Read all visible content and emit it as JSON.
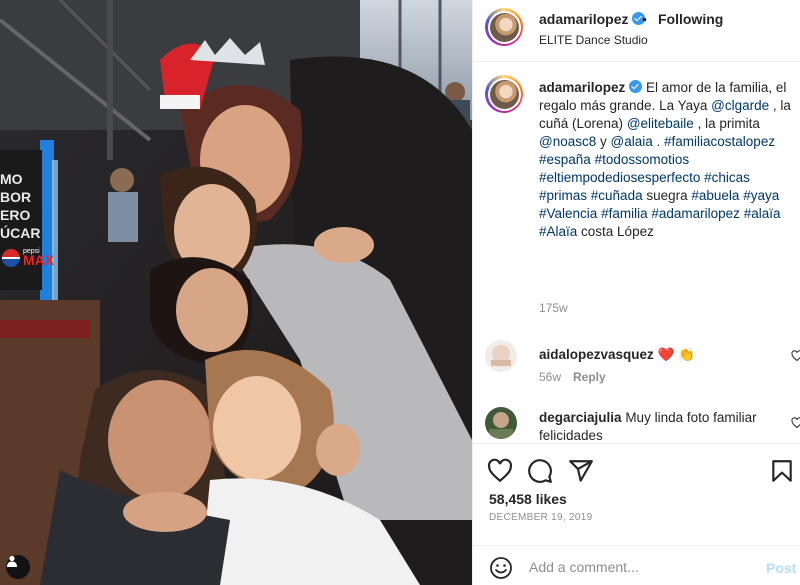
{
  "post": {
    "username": "adamarilopez",
    "follow_status": "Following",
    "separator": "•",
    "location": "ELITE Dance Studio"
  },
  "photo": {
    "description_icons": [
      "user-tag-icon"
    ],
    "signage": [
      "MO",
      "BOR",
      "ERO",
      "ÚCAR",
      "pepsi",
      "MAX"
    ]
  },
  "caption": {
    "username": "adamarilopez",
    "segments": [
      {
        "t": "El amor de la familia, el regalo más grande. La Yaya ",
        "link": false
      },
      {
        "t": "@clgarde",
        "link": true
      },
      {
        "t": " , la cuñá (Lorena) ",
        "link": false
      },
      {
        "t": "@elitebaile",
        "link": true
      },
      {
        "t": " , la primita ",
        "link": false
      },
      {
        "t": "@noasc8",
        "link": true
      },
      {
        "t": " y ",
        "link": false
      },
      {
        "t": "@alaia",
        "link": true
      },
      {
        "t": " . ",
        "link": false
      },
      {
        "t": "#familiacostalopez",
        "link": true
      },
      {
        "t": " ",
        "link": false
      },
      {
        "t": "#españa",
        "link": true
      },
      {
        "t": " ",
        "link": false
      },
      {
        "t": "#todossomotios",
        "link": true
      },
      {
        "t": " ",
        "link": false
      },
      {
        "t": "#eltiempodediosesperfecto",
        "link": true
      },
      {
        "t": " ",
        "link": false
      },
      {
        "t": "#chicas",
        "link": true
      },
      {
        "t": " ",
        "link": false
      },
      {
        "t": "#primas",
        "link": true
      },
      {
        "t": " ",
        "link": false
      },
      {
        "t": "#cuñada",
        "link": true
      },
      {
        "t": " suegra ",
        "link": false
      },
      {
        "t": "#abuela",
        "link": true
      },
      {
        "t": " ",
        "link": false
      },
      {
        "t": "#yaya",
        "link": true
      },
      {
        "t": " ",
        "link": false
      },
      {
        "t": "#Valencia",
        "link": true
      },
      {
        "t": " ",
        "link": false
      },
      {
        "t": "#familia",
        "link": true
      },
      {
        "t": " ",
        "link": false
      },
      {
        "t": "#adamarilopez",
        "link": true
      },
      {
        "t": " ",
        "link": false
      },
      {
        "t": "#alaïa",
        "link": true
      },
      {
        "t": " ",
        "link": false
      },
      {
        "t": "#Alaïa",
        "link": true
      },
      {
        "t": " costa López",
        "link": false
      }
    ],
    "time": "175w"
  },
  "comments": [
    {
      "username": "aidalopezvasquez",
      "text": "❤️ 👏",
      "time": "56w",
      "reply_label": "Reply"
    },
    {
      "username": "degarciajulia",
      "text": "Muy linda foto familiar felicidades",
      "time": "",
      "reply_label": ""
    }
  ],
  "actions": {
    "icons": [
      "heart-icon",
      "comment-icon",
      "share-icon",
      "bookmark-icon"
    ],
    "likes": "58,458 likes",
    "date": "DECEMBER 19, 2019"
  },
  "add_comment": {
    "placeholder": "Add a comment...",
    "post_label": "Post"
  },
  "colors": {
    "link": "#00376b",
    "verified": "#3897f0",
    "secondary_text": "#8e8e8e",
    "post_disabled": "#b2dffc",
    "heart_red": "#ed4956"
  }
}
